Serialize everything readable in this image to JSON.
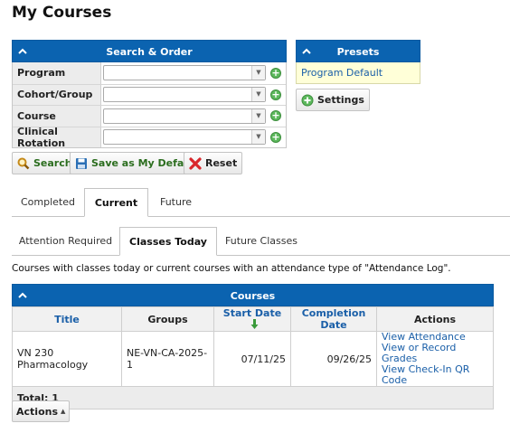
{
  "page_title": "My Courses",
  "search_panel": {
    "title": "Search & Order",
    "filters": [
      {
        "label": "Program",
        "value": ""
      },
      {
        "label": "Cohort/Group",
        "value": ""
      },
      {
        "label": "Course",
        "value": ""
      },
      {
        "label": "Clinical Rotation",
        "value": ""
      }
    ],
    "buttons": {
      "search": "Search",
      "save_default": "Save as My Default",
      "reset": "Reset"
    }
  },
  "presets": {
    "title": "Presets",
    "items": [
      "Program Default"
    ],
    "settings_label": "Settings"
  },
  "primary_tabs": [
    {
      "label": "Completed",
      "active": false
    },
    {
      "label": "Current",
      "active": true
    },
    {
      "label": "Future",
      "active": false
    }
  ],
  "secondary_tabs": [
    {
      "label": "Attention Required",
      "active": false
    },
    {
      "label": "Classes Today",
      "active": true
    },
    {
      "label": "Future Classes",
      "active": false
    }
  ],
  "description": "Courses with classes today or current courses with an attendance type of \"Attendance Log\".",
  "courses": {
    "title": "Courses",
    "columns": [
      "Title",
      "Groups",
      "Start Date",
      "Completion Date",
      "Actions"
    ],
    "rows": [
      {
        "title": "VN 230 Pharmacology",
        "groups": "NE-VN-CA-2025-1",
        "start_date": "07/11/25",
        "completion_date": "09/26/25",
        "actions": [
          "View Attendance",
          "View or Record Grades",
          "View Check-In QR Code"
        ]
      }
    ],
    "total": "Total: 1"
  },
  "actions_button": "Actions",
  "colors": {
    "header_blue": "#0b63b0",
    "link_blue": "#1a5fa8",
    "preset_bg": "#ffffd8",
    "green_accent": "#5cb85c"
  }
}
